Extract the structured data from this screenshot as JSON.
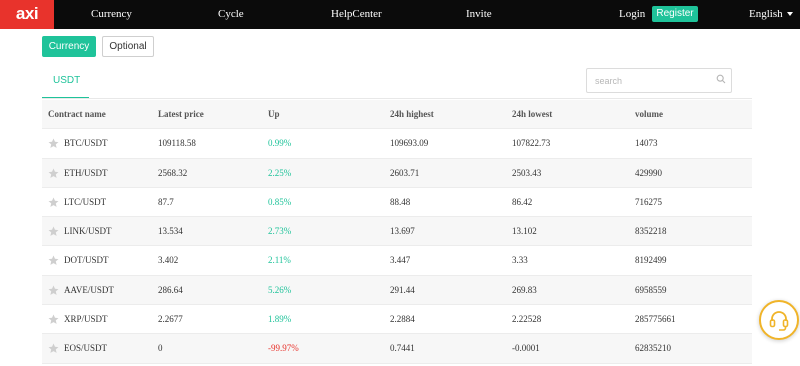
{
  "brand": {
    "logo_text": "axi",
    "logo_color": "#e8332c"
  },
  "nav": {
    "items": [
      {
        "label": "Currency"
      },
      {
        "label": "Cycle"
      },
      {
        "label": "HelpCenter"
      },
      {
        "label": "Invite"
      }
    ],
    "login_label": "Login",
    "register_label": "Register",
    "language": "English"
  },
  "toggles": {
    "active_label": "Currency",
    "inactive_label": "Optional"
  },
  "tabs": {
    "active_label": "USDT"
  },
  "search": {
    "placeholder": "search"
  },
  "table": {
    "headers": [
      "Contract name",
      "Latest price",
      "Up",
      "24h highest",
      "24h lowest",
      "volume"
    ],
    "rows": [
      {
        "pair": "BTC/USDT",
        "price": "109118.58",
        "up": "0.99%",
        "high": "109693.09",
        "low": "107822.73",
        "volume": "14073",
        "direction": "up"
      },
      {
        "pair": "ETH/USDT",
        "price": "2568.32",
        "up": "2.25%",
        "high": "2603.71",
        "low": "2503.43",
        "volume": "429990",
        "direction": "up"
      },
      {
        "pair": "LTC/USDT",
        "price": "87.7",
        "up": "0.85%",
        "high": "88.48",
        "low": "86.42",
        "volume": "716275",
        "direction": "up"
      },
      {
        "pair": "LINK/USDT",
        "price": "13.534",
        "up": "2.73%",
        "high": "13.697",
        "low": "13.102",
        "volume": "8352218",
        "direction": "up"
      },
      {
        "pair": "DOT/USDT",
        "price": "3.402",
        "up": "2.11%",
        "high": "3.447",
        "low": "3.33",
        "volume": "8192499",
        "direction": "up"
      },
      {
        "pair": "AAVE/USDT",
        "price": "286.64",
        "up": "5.26%",
        "high": "291.44",
        "low": "269.83",
        "volume": "6958559",
        "direction": "up"
      },
      {
        "pair": "XRP/USDT",
        "price": "2.2677",
        "up": "1.89%",
        "high": "2.2884",
        "low": "2.22528",
        "volume": "285775661",
        "direction": "up"
      },
      {
        "pair": "EOS/USDT",
        "price": "0",
        "up": "-99.97%",
        "high": "0.7441",
        "low": "-0.0001",
        "volume": "62835210",
        "direction": "down"
      }
    ]
  },
  "colors": {
    "accent": "#1fc39a",
    "negative": "#e8332c",
    "topbar": "#0b0b0b",
    "support_ring": "#f0b429"
  },
  "icons": {
    "star": "star-icon",
    "search": "search-icon",
    "support": "headset-icon",
    "language": "chevron-down-icon"
  }
}
